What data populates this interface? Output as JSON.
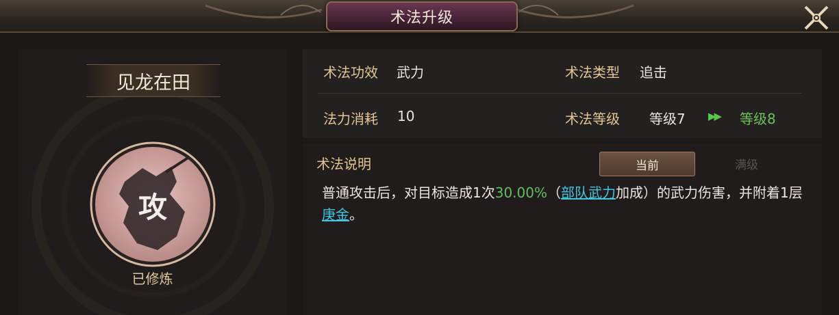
{
  "dialog": {
    "title": "术法升级"
  },
  "skill": {
    "name": "见龙在田",
    "icon_char": "攻",
    "status": "已修炼"
  },
  "info": {
    "effect_label": "术法功效",
    "effect_value": "武力",
    "type_label": "术法类型",
    "type_value": "追击",
    "cost_label": "法力消耗",
    "cost_value": "10",
    "level_label": "术法等级",
    "level_current": "等级7",
    "level_next": "等级8",
    "arrow_icon": "double-chevron-right-icon"
  },
  "description": {
    "title": "术法说明",
    "tabs": {
      "current": "当前",
      "max": "满级"
    },
    "text_before": "普通攻击后，对目标造成1次",
    "percent": "30.00%",
    "paren_open": "（",
    "keyword1": "部队武力",
    "text_middle": "加成）的武力伤害，并附着1层",
    "keyword2": "庚金",
    "text_end": "。"
  },
  "colors": {
    "label_gold": "#e3c693",
    "green": "#62bf5a",
    "cyan_link": "#3fc7e2",
    "title_plate": "#4f2839"
  }
}
